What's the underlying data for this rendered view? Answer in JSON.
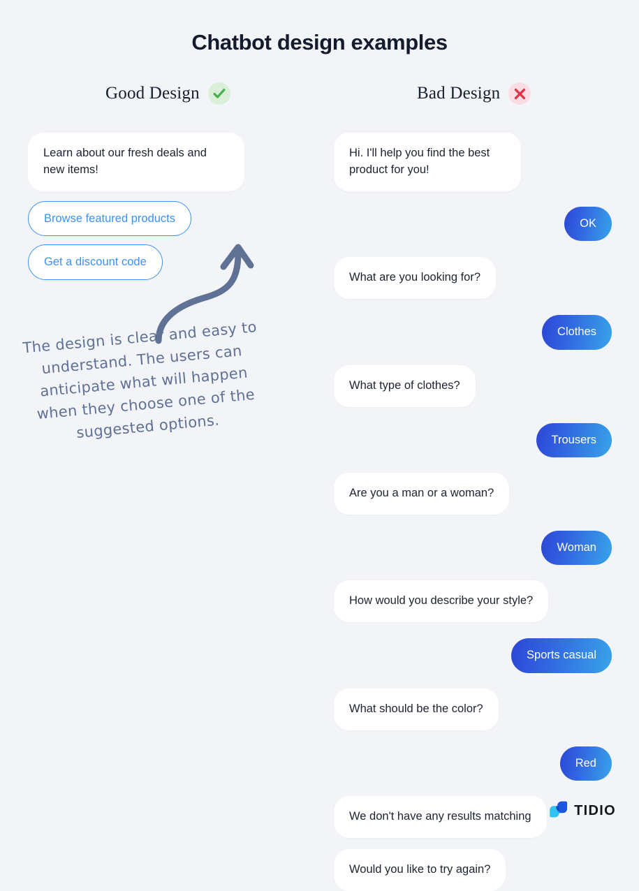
{
  "page": {
    "title": "Chatbot design examples",
    "background_color": "#f2f4f8"
  },
  "columns": {
    "good": {
      "label": "Good Design",
      "badge_icon": "green-check-icon",
      "badge_color": "#4caf50",
      "badge_bg": "#d9efd8",
      "messages": [
        {
          "type": "bot",
          "text": "Learn about our fresh deals and new items!"
        },
        {
          "type": "quick_reply",
          "text": "Browse featured products"
        },
        {
          "type": "quick_reply",
          "text": "Get a discount code"
        }
      ]
    },
    "bad": {
      "label": "Bad Design",
      "badge_icon": "red-cross-icon",
      "badge_color": "#e0334a",
      "badge_bg": "#fadde2",
      "messages": [
        {
          "type": "bot",
          "text": "Hi. I'll help you find the best product for you!"
        },
        {
          "type": "user",
          "text": "OK"
        },
        {
          "type": "bot",
          "text": "What are you looking for?"
        },
        {
          "type": "user",
          "text": "Clothes"
        },
        {
          "type": "bot",
          "text": "What type of clothes?"
        },
        {
          "type": "user",
          "text": "Trousers"
        },
        {
          "type": "bot",
          "text": "Are you a man or a woman?"
        },
        {
          "type": "user",
          "text": "Woman"
        },
        {
          "type": "bot",
          "text": "How would you describe your style?"
        },
        {
          "type": "user",
          "text": "Sports casual"
        },
        {
          "type": "bot",
          "text": "What should be the color?"
        },
        {
          "type": "user",
          "text": "Red"
        },
        {
          "type": "bot",
          "text": "We don't have any results matching"
        },
        {
          "type": "bot",
          "text": "Would you like to try again?"
        }
      ]
    }
  },
  "annotation": {
    "text": "The design is clear and easy to understand. The users can anticipate what will happen when they choose one of the suggested options.",
    "color": "#5f7195",
    "arrow_icon": "curved-arrow-up-icon"
  },
  "logo": {
    "wordmark": "TIDIO",
    "mark_icon": "tidio-logo-icon",
    "color_dark": "#1b55e0",
    "color_light": "#19bef0"
  },
  "theme": {
    "user_bubble_gradient_start": "#2c46d6",
    "user_bubble_gradient_end": "#38a4e9",
    "quick_reply_blue": "#3b92f5",
    "bot_bubble_bg": "#ffffff"
  }
}
